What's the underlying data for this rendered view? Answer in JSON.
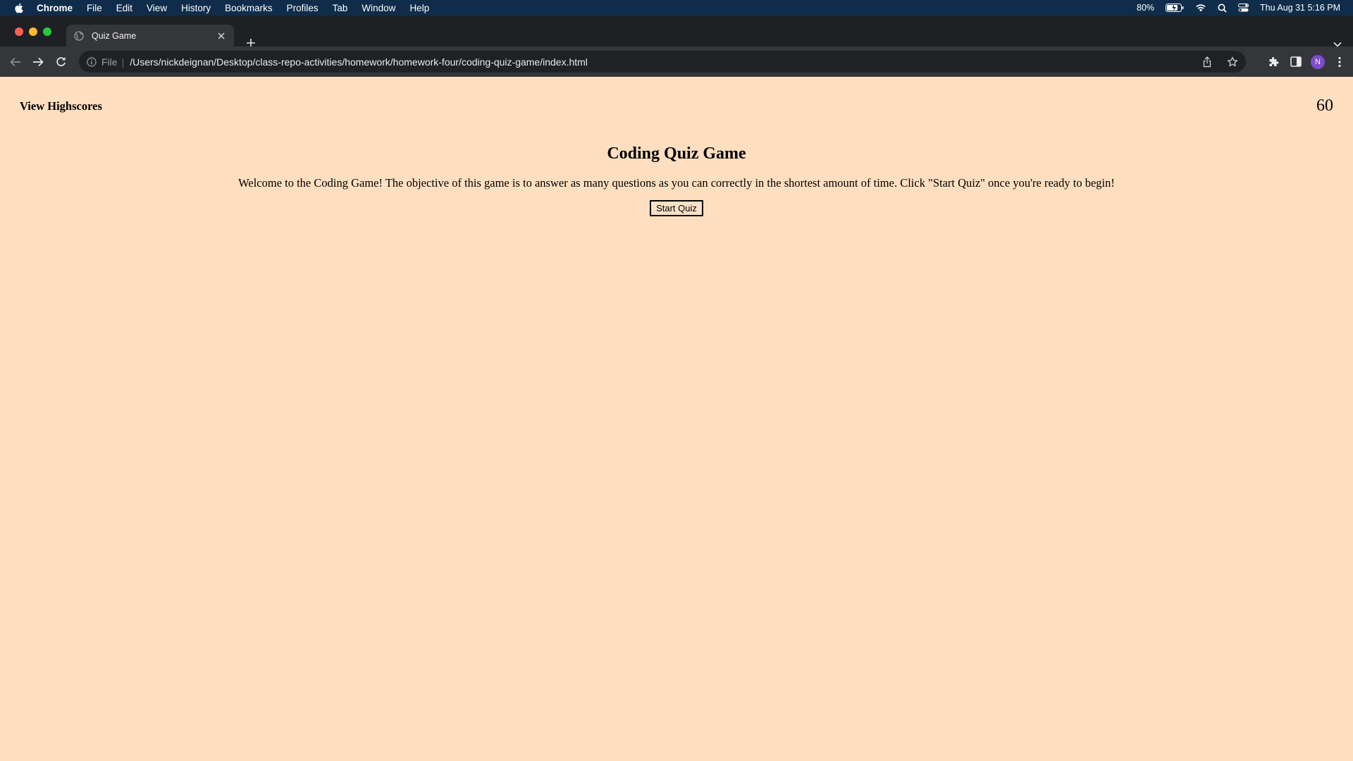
{
  "menubar": {
    "app": "Chrome",
    "items": [
      "File",
      "Edit",
      "View",
      "History",
      "Bookmarks",
      "Profiles",
      "Tab",
      "Window",
      "Help"
    ],
    "battery": "80%",
    "datetime": "Thu Aug 31  5:16 PM"
  },
  "browser": {
    "tab_title": "Quiz Game",
    "omnibox_scheme": "File",
    "url": "/Users/nickdeignan/Desktop/class-repo-activities/homework/homework-four/coding-quiz-game/index.html",
    "profile_initial": "N"
  },
  "page": {
    "highscores_link": "View Highscores",
    "timer": "60",
    "title": "Coding Quiz Game",
    "intro": "Welcome to the Coding Game! The objective of this game is to answer as many questions as you can correctly in the shortest amount of time. Click \"Start Quiz\" once you're ready to begin!",
    "start_button": "Start Quiz"
  },
  "colors": {
    "page_background": "#ffdfc0",
    "menubar": "#0f2d4a",
    "tabstrip": "#1f2024",
    "toolbar": "#35363a",
    "profile": "#7c4dcc"
  }
}
